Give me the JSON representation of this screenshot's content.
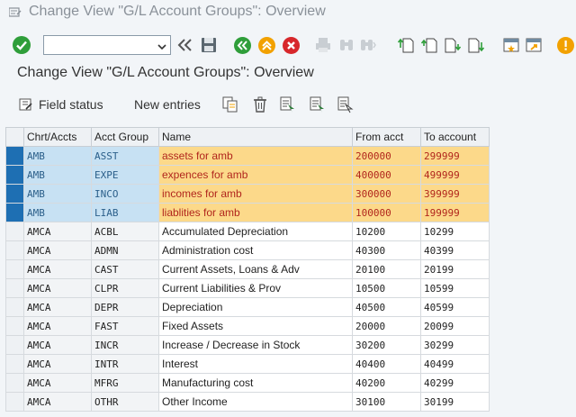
{
  "window": {
    "title": "Change View \"G/L Account Groups\": Overview"
  },
  "command_field": {
    "value": "",
    "placeholder": ""
  },
  "page": {
    "heading": "Change View \"G/L Account Groups\": Overview"
  },
  "app_toolbar": {
    "field_status": "Field status",
    "new_entries": "New entries"
  },
  "table": {
    "headers": {
      "chrt": "Chrt/Accts",
      "group": "Acct Group",
      "name": "Name",
      "from": "From acct",
      "to": "To account"
    },
    "rows": [
      {
        "chrt": "AMB",
        "group": "ASST",
        "name": "assets for amb",
        "from": "200000",
        "to": "299999",
        "highlight": true
      },
      {
        "chrt": "AMB",
        "group": "EXPE",
        "name": "expences for amb",
        "from": "400000",
        "to": "499999",
        "highlight": true
      },
      {
        "chrt": "AMB",
        "group": "INCO",
        "name": "incomes for amb",
        "from": "300000",
        "to": "399999",
        "highlight": true
      },
      {
        "chrt": "AMB",
        "group": "LIAB",
        "name": "liablities for amb",
        "from": "100000",
        "to": "199999",
        "highlight": true
      },
      {
        "chrt": "AMCA",
        "group": "ACBL",
        "name": "Accumulated Depreciation",
        "from": "10200",
        "to": "10299"
      },
      {
        "chrt": "AMCA",
        "group": "ADMN",
        "name": "Administration cost",
        "from": "40300",
        "to": "40399"
      },
      {
        "chrt": "AMCA",
        "group": "CAST",
        "name": "Current Assets, Loans & Adv",
        "from": "20100",
        "to": "20199"
      },
      {
        "chrt": "AMCA",
        "group": "CLPR",
        "name": "Current Liabilities & Prov",
        "from": "10500",
        "to": "10599"
      },
      {
        "chrt": "AMCA",
        "group": "DEPR",
        "name": "Depreciation",
        "from": "40500",
        "to": "40599"
      },
      {
        "chrt": "AMCA",
        "group": "FAST",
        "name": "Fixed Assets",
        "from": "20000",
        "to": "20099"
      },
      {
        "chrt": "AMCA",
        "group": "INCR",
        "name": "Increase / Decrease in Stock",
        "from": "30200",
        "to": "30299"
      },
      {
        "chrt": "AMCA",
        "group": "INTR",
        "name": "Interest",
        "from": "40400",
        "to": "40499"
      },
      {
        "chrt": "AMCA",
        "group": "MFRG",
        "name": "Manufacturing cost",
        "from": "40200",
        "to": "40299"
      },
      {
        "chrt": "AMCA",
        "group": "OTHR",
        "name": "Other Income",
        "from": "30100",
        "to": "30199"
      }
    ]
  },
  "icons": {
    "back": "double-chevron-left-icon",
    "save": "save-icon",
    "exit": "exit-icon",
    "up": "up-icon",
    "cancel": "cancel-icon",
    "print": "printer-icon",
    "find": "binoculars-icon",
    "find_next": "binoculars-next-icon",
    "first_page": "first-page-icon",
    "prev_page": "previous-page-icon",
    "next_page": "next-page-icon",
    "last_page": "last-page-icon",
    "new_session": "new-session-icon",
    "shortcut": "shortcut-icon",
    "help": "help-icon"
  },
  "colors": {
    "ok": "#2f9e3a",
    "exit": "#2f9e3a",
    "up": "#f2a100",
    "cancel": "#d7272b",
    "help": "#f2a100",
    "highlight_row": "#fcd98a",
    "highlight_key": "#c7e1f3",
    "selected_marker": "#1e6fb3"
  }
}
